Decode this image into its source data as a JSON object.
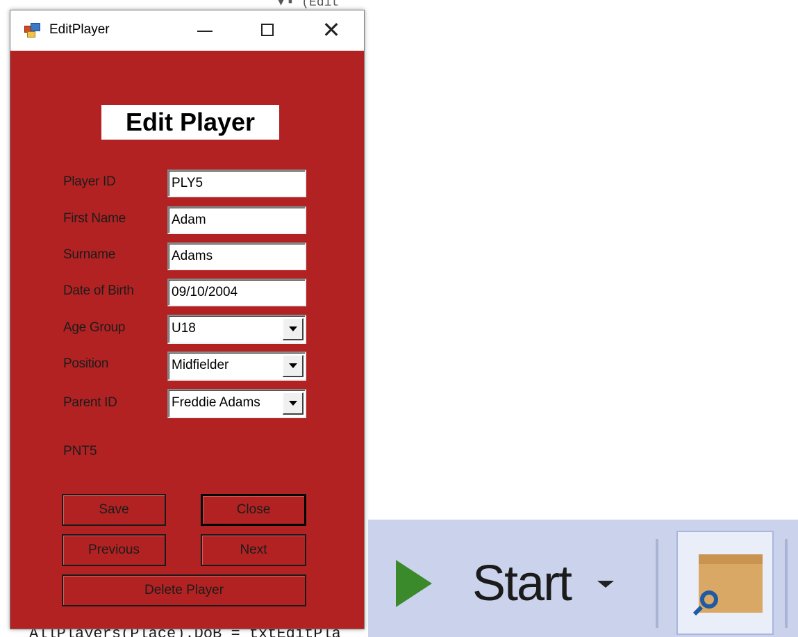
{
  "window": {
    "title": "EditPlayer"
  },
  "form": {
    "heading": "Edit Player",
    "labels": {
      "player_id": "Player ID",
      "first_name": "First Name",
      "surname": "Surname",
      "dob": "Date of Birth",
      "age_group": "Age Group",
      "position": "Position",
      "parent_id": "Parent ID"
    },
    "values": {
      "player_id": "PLY5",
      "first_name": "Adam",
      "surname": "Adams",
      "dob": "09/10/2004",
      "age_group": "U18",
      "position": "Midfielder",
      "parent_id": "Freddie Adams"
    },
    "parent_id_text": "PNT5",
    "buttons": {
      "save": "Save",
      "close": "Close",
      "previous": "Previous",
      "next": "Next",
      "delete": "Delete Player"
    }
  },
  "background": {
    "code_line": "AllPlayers(Place).DoB = txtEditPla",
    "code_top": "▾ ▪ (Edit"
  },
  "toolbar": {
    "start_label": "Start"
  },
  "colors": {
    "form_bg": "#b22222",
    "toolbar_bg": "#cbd3ec",
    "play_green": "#3a8a2c"
  }
}
